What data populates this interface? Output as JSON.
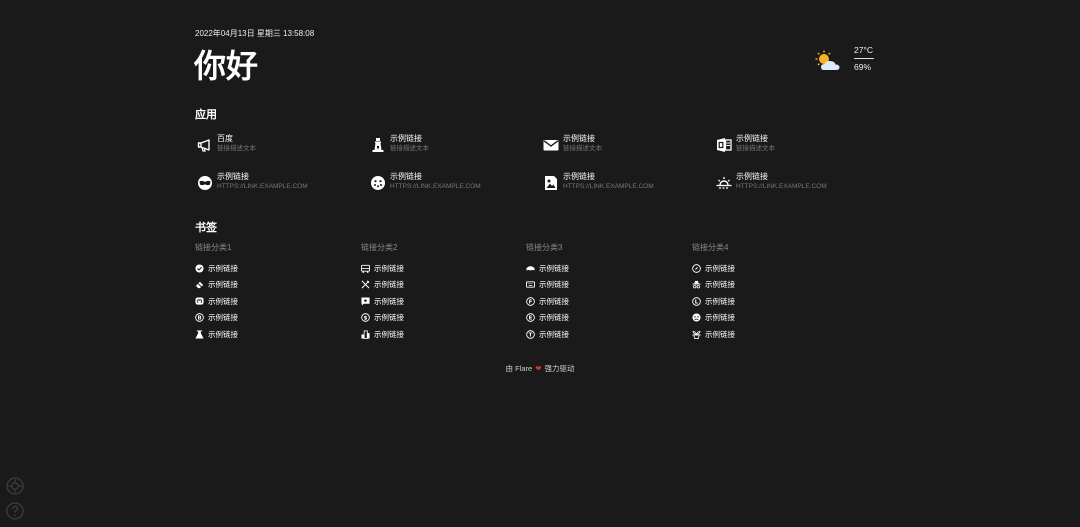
{
  "datetime": "2022年04月13日 星期三 13:58:08",
  "greeting": "你好",
  "weather": {
    "temperature": "27°C",
    "humidity": "69%",
    "icon": "partly-cloudy-icon"
  },
  "apps": {
    "title": "应用",
    "items": [
      {
        "name": "百度",
        "desc": "链接描述文本",
        "icon": "megaphone-icon"
      },
      {
        "name": "示例链接",
        "desc": "链接描述文本",
        "icon": "lighthouse-icon"
      },
      {
        "name": "示例链接",
        "desc": "链接描述文本",
        "icon": "mail-icon"
      },
      {
        "name": "示例链接",
        "desc": "链接描述文本",
        "icon": "office-icon"
      },
      {
        "name": "示例链接",
        "desc": "HTTPS://LINK.EXAMPLE.COM",
        "icon": "mask-icon"
      },
      {
        "name": "示例链接",
        "desc": "HTTPS://LINK.EXAMPLE.COM",
        "icon": "smile-face-icon"
      },
      {
        "name": "示例链接",
        "desc": "HTTPS://LINK.EXAMPLE.COM",
        "icon": "image-icon"
      },
      {
        "name": "示例链接",
        "desc": "HTTPS://LINK.EXAMPLE.COM",
        "icon": "sunset-icon"
      }
    ]
  },
  "bookmarks": {
    "title": "书签",
    "categories": [
      {
        "name": "链接分类1",
        "links": [
          "示例链接",
          "示例链接",
          "示例链接",
          "示例链接",
          "示例链接"
        ],
        "icons": [
          "check-badge-icon",
          "eraser-icon",
          "mastodon-icon",
          "bitcoin-icon",
          "flask-icon"
        ]
      },
      {
        "name": "链接分类2",
        "links": [
          "示例链接",
          "示例链接",
          "示例链接",
          "示例链接",
          "示例链接"
        ],
        "icons": [
          "bus-icon",
          "tools-icon",
          "comment-photo-icon",
          "dollar-circle-icon",
          "city-icon"
        ]
      },
      {
        "name": "链接分类3",
        "links": [
          "示例链接",
          "示例链接",
          "示例链接",
          "示例链接",
          "示例链接"
        ],
        "icons": [
          "car-icon",
          "keyboard-icon",
          "f-circle-icon",
          "e-circle-icon",
          "t-circle-icon"
        ]
      },
      {
        "name": "链接分类4",
        "links": [
          "示例链接",
          "示例链接",
          "示例链接",
          "示例链接",
          "示例链接"
        ],
        "icons": [
          "compass-icon",
          "incognito-icon",
          "l-circle-icon",
          "angry-face-icon",
          "plant-pot-icon"
        ]
      }
    ]
  },
  "footer": {
    "prefix": "由 Flare",
    "suffix": "强力驱动"
  },
  "controls": {
    "settings_icon": "settings-icon",
    "help_icon": "help-icon"
  }
}
